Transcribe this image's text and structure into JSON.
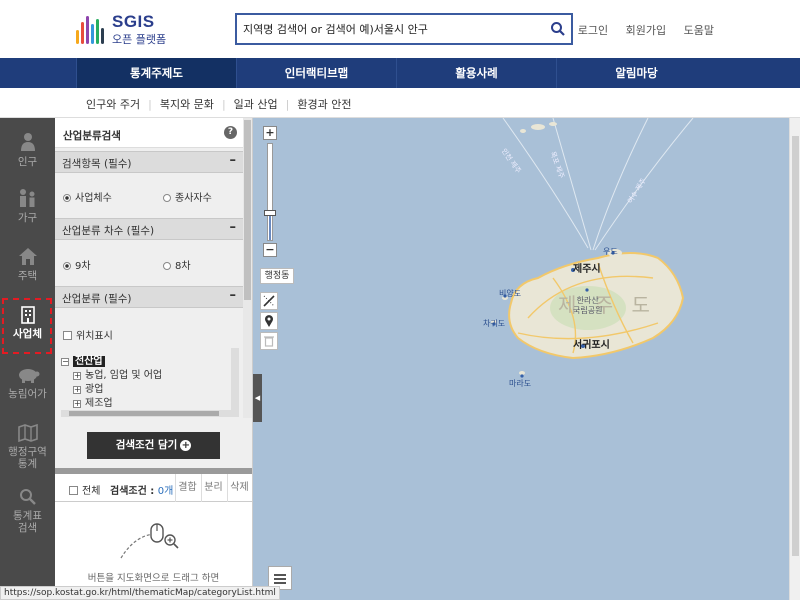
{
  "header": {
    "brand": "SGIS",
    "brand_sub": "오픈 플랫폼",
    "search_value": "지역명 검색어 or 검색어 예)서울시 안구",
    "links": [
      "로그인",
      "회원가입",
      "도움말"
    ]
  },
  "gnb": {
    "items": [
      "통계주제도",
      "인터랙티브맵",
      "활용사례",
      "알림마당"
    ],
    "active_index": 0
  },
  "submenu": {
    "items": [
      "인구와 주거",
      "복지와 문화",
      "일과 산업",
      "환경과 안전"
    ]
  },
  "leftnav": {
    "items": [
      {
        "label": "인구",
        "icon": "person-icon"
      },
      {
        "label": "가구",
        "icon": "family-icon"
      },
      {
        "label": "주택",
        "icon": "house-icon"
      },
      {
        "label": "사업체",
        "icon": "building-icon"
      },
      {
        "label": "농림어가",
        "icon": "pig-icon"
      },
      {
        "label": "행정구역\n통계",
        "icon": "map-icon"
      },
      {
        "label": "통계표\n검색",
        "icon": "search-icon"
      }
    ],
    "active_index": 3,
    "active_highlight_color": "#e31b23"
  },
  "panel": {
    "title": "산업분류검색",
    "help_icon": "?",
    "sections": {
      "search_item": {
        "title": "검색항목 (필수)",
        "options": [
          "사업체수",
          "종사자수"
        ],
        "selected_index": 0
      },
      "industry_level": {
        "title": "산업분류 차수 (필수)",
        "options": [
          "9차",
          "8차"
        ],
        "selected_index": 0
      },
      "industry": {
        "title": "산업분류 (필수)",
        "location_check": "위치표시",
        "tree": [
          {
            "label": "전산업",
            "root": true
          },
          {
            "label": "농업, 임업 및 어업"
          },
          {
            "label": "광업"
          },
          {
            "label": "제조업"
          }
        ]
      }
    },
    "submit_label": "검색조건 담기",
    "conditions": {
      "all_label": "전체",
      "label": "검색조건 :",
      "count": "0개",
      "buttons": [
        "결합",
        "분리",
        "삭제"
      ]
    },
    "drag_message": "버튼을 지도화면으로 드래그 하면"
  },
  "map": {
    "admin_button": "행정동",
    "island_label": "제 주 도",
    "labels": {
      "jeju_city": "제주시",
      "seogwipo": "서귀포시",
      "hallasan": "한라산\n국립공원",
      "biyangdo": "비양도",
      "chagwido": "차귀도",
      "marado": "마라도",
      "udo": "우도",
      "shipping1": "인천 제주",
      "shipping2": "목포 제주",
      "shipping3": "여수 제주"
    },
    "colors": {
      "sea": "#a9c0d7",
      "land": "#e9e6d6",
      "road": "#f2c86a"
    }
  },
  "status_url": "https://sop.kostat.go.kr/html/thematicMap/categoryList.html"
}
